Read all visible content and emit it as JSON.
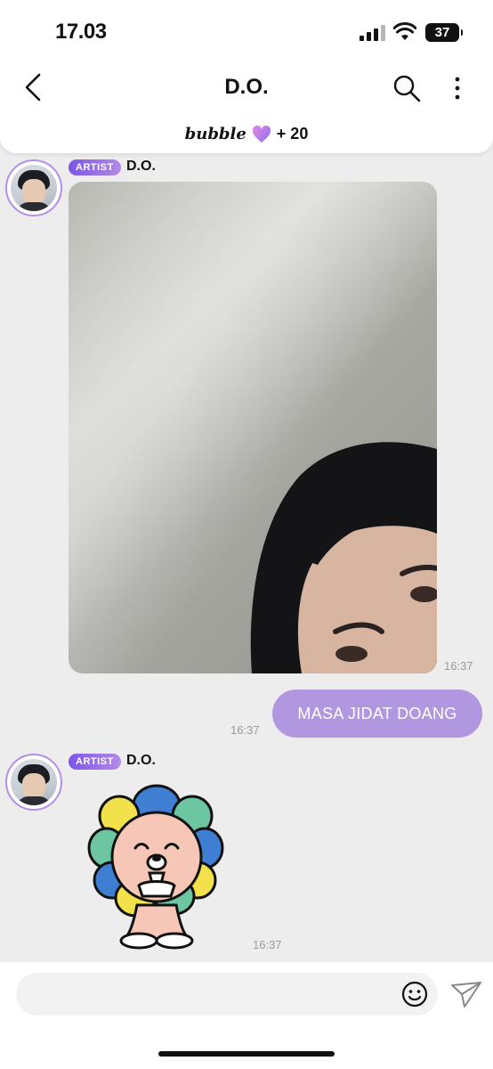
{
  "status_bar": {
    "time": "17.03",
    "battery": "37"
  },
  "header": {
    "title": "D.O."
  },
  "bubble_bar": {
    "logo": "bubble",
    "count": "+ 20"
  },
  "messages": [
    {
      "sender": "D.O.",
      "badge": "ARTIST",
      "type": "photo",
      "time": "16:37"
    },
    {
      "sender": "me",
      "type": "text",
      "text": "MASA JIDAT DOANG",
      "time": "16:37"
    },
    {
      "sender": "D.O.",
      "badge": "ARTIST",
      "type": "sticker",
      "time": "16:37"
    }
  ],
  "composer": {
    "placeholder": ""
  },
  "icons": {
    "back": "chevron-left-icon",
    "search": "search-icon",
    "more": "more-vertical-icon",
    "emoji": "smiley-icon",
    "send": "send-icon",
    "heart": "heart-icon"
  },
  "colors": {
    "accent": "#b197e0",
    "badge_start": "#7b55e8",
    "badge_end": "#b48ae8"
  }
}
